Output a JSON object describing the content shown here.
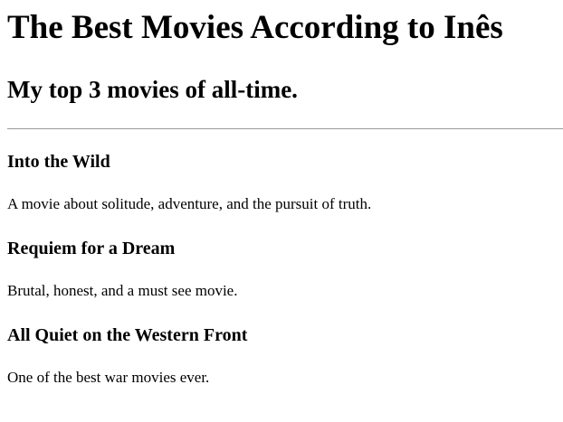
{
  "page": {
    "title": "The Best Movies According to Inês",
    "subtitle": "My top 3 movies of all-time."
  },
  "movies": [
    {
      "title": "Into the Wild",
      "description": "A movie about solitude, adventure, and the pursuit of truth."
    },
    {
      "title": "Requiem for a Dream",
      "description": "Brutal, honest, and a must see movie."
    },
    {
      "title": "All Quiet on the Western Front",
      "description": "One of the best war movies ever."
    }
  ]
}
